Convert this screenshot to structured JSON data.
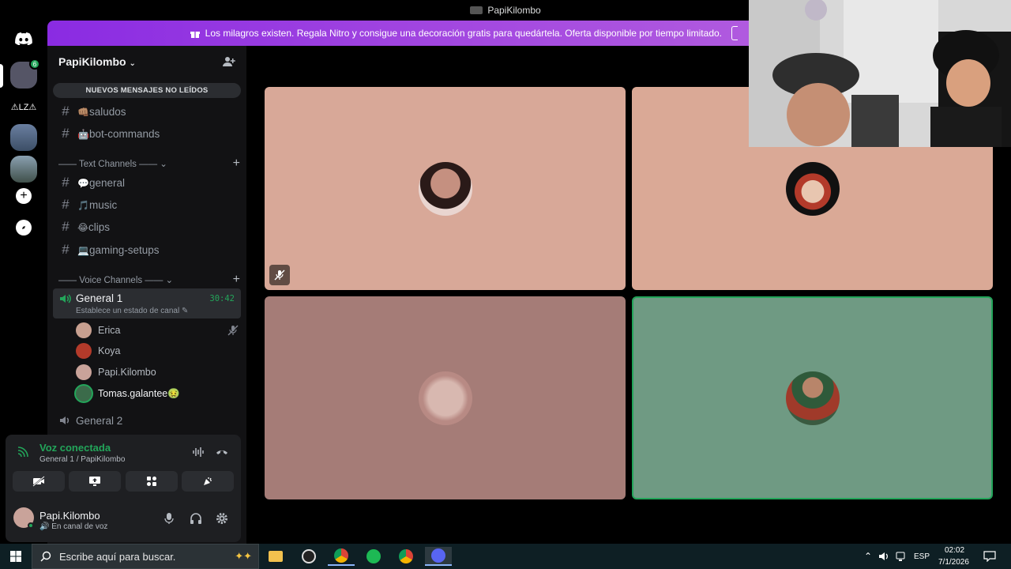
{
  "window": {
    "title": "PapiKilombo"
  },
  "banner": {
    "text": "Los milagros existen. Regala Nitro y consigue una decoración gratis para quedártela. Oferta disponible por tiempo limitado."
  },
  "rail": {
    "badge": "6",
    "server_label": "⚠LZ⚠"
  },
  "server": {
    "name": "PapiKilombo"
  },
  "unread_banner": "NUEVOS MENSAJES NO LEÍDOS",
  "top_channels": [
    {
      "emoji": "👊🏽",
      "name": "saludos"
    },
    {
      "emoji": "🤖",
      "name": "bot-commands"
    }
  ],
  "text_category": "Text Channels",
  "text_channels": [
    {
      "emoji": "💬",
      "name": "general"
    },
    {
      "emoji": "🎵",
      "name": "music"
    },
    {
      "emoji": "😂",
      "name": "clips"
    },
    {
      "emoji": "💻",
      "name": "gaming-setups"
    }
  ],
  "voice_category": "Voice Channels",
  "voice_active": {
    "name": "General 1",
    "time": "30:42",
    "status": "Establece un estado de canal"
  },
  "voice_members": [
    {
      "name": "Erica",
      "color": "#c8a090"
    },
    {
      "name": "Koya",
      "color": "#b33a2a"
    },
    {
      "name": "Papi.Kilombo",
      "color": "#c9a39a"
    },
    {
      "name": "Tomas.galantee🤢",
      "color": "#3b6b4a"
    }
  ],
  "voice_other": {
    "name": "General 2"
  },
  "voice_panel": {
    "title": "Voz conectada",
    "subtitle": "General 1 / PapiKilombo"
  },
  "user": {
    "name": "Papi.Kilombo",
    "status": "En canal de voz"
  },
  "tiles": [
    {
      "name": "Erica",
      "color": "#d8a898"
    },
    {
      "name": "Koya",
      "color": "#daa996"
    },
    {
      "name": "Papi.Kilombo",
      "color": "#a57c77"
    },
    {
      "name": "Tomas.galantee",
      "color": "#6f9a83"
    }
  ],
  "taskbar": {
    "search_placeholder": "Escribe aquí para buscar.",
    "lang": "ESP",
    "time": "02:02",
    "date": "7/1/2026"
  }
}
